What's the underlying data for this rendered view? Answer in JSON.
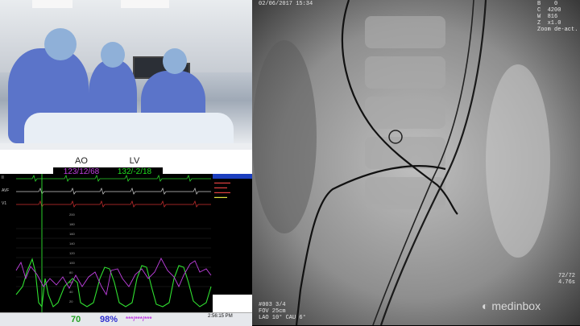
{
  "hemo": {
    "ao": {
      "label": "AO",
      "value": "123/12/68"
    },
    "lv": {
      "label": "LV",
      "value": "132/-2/18"
    },
    "status": {
      "hr": "70",
      "spo2": "98%",
      "nibp": "***/***/***",
      "time": "2:56:15 PM"
    },
    "scale_ticks": [
      "200",
      "180",
      "160",
      "140",
      "120",
      "100",
      "80",
      "60",
      "40",
      "20"
    ],
    "colors": {
      "ao": "#c040e0",
      "lv": "#20e020",
      "spo2": "#3030d0"
    }
  },
  "fluoro": {
    "date_time": "02/06/2017 15:34",
    "top_right": [
      "B    0",
      "C  4200",
      "W  816",
      "Z  x1.0",
      "Zoom de-act."
    ],
    "series": "#003 3/4",
    "fov": "FOV 25cm",
    "angle": "LAO 10° CAU 6°",
    "frame": "72/72",
    "duration": "4.76s",
    "logo": "medinbox"
  }
}
